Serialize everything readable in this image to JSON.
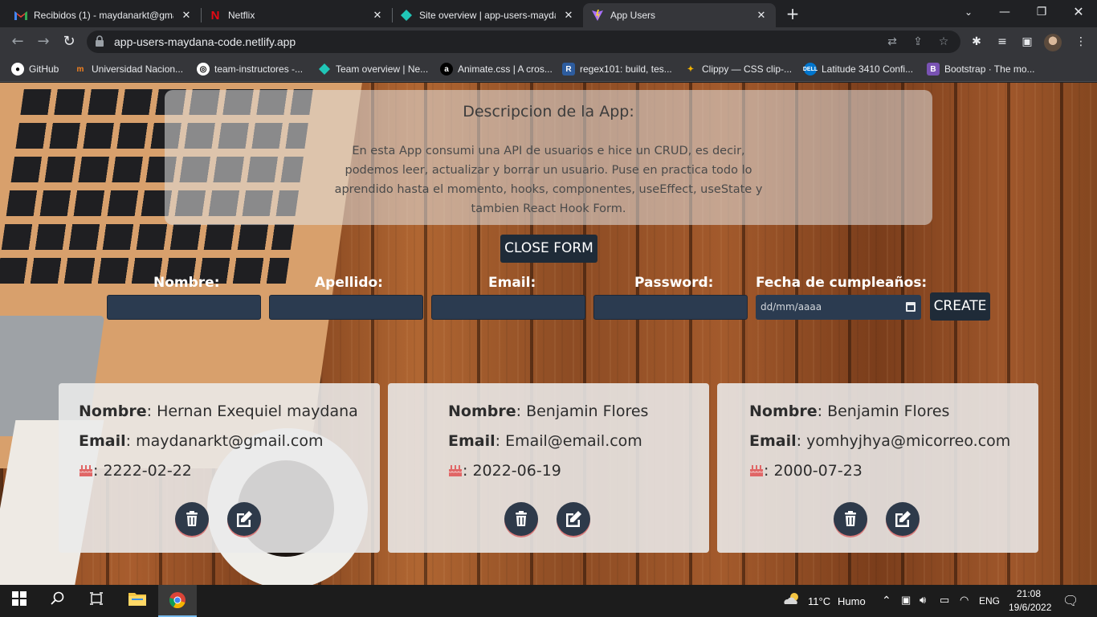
{
  "browser": {
    "tabs": [
      {
        "title": "Recibidos (1) - maydanarkt@gma",
        "icon": "gmail-icon",
        "active": false
      },
      {
        "title": "Netflix",
        "icon": "netflix-icon",
        "active": false
      },
      {
        "title": "Site overview | app-users-mayda",
        "icon": "netlify-icon",
        "active": false
      },
      {
        "title": "App Users",
        "icon": "vite-icon",
        "active": true
      }
    ],
    "url": "app-users-maydana-code.netlify.app",
    "bookmarks": [
      {
        "label": "GitHub",
        "icon": "github-icon"
      },
      {
        "label": "Universidad Nacion...",
        "icon": "university-icon"
      },
      {
        "label": "team-instructores -...",
        "icon": "team-icon"
      },
      {
        "label": "Team overview | Ne...",
        "icon": "netlify-icon"
      },
      {
        "label": "Animate.css | A cros...",
        "icon": "animate-icon"
      },
      {
        "label": "regex101: build, tes...",
        "icon": "regex-icon"
      },
      {
        "label": "Clippy — CSS clip-...",
        "icon": "clippy-icon"
      },
      {
        "label": "Latitude 3410 Confi...",
        "icon": "dell-icon"
      },
      {
        "label": "Bootstrap · The mo...",
        "icon": "bootstrap-icon"
      }
    ]
  },
  "page": {
    "description": {
      "title": "Descripcion de la App:",
      "body": "En esta App consumi una API de usuarios e hice un CRUD, es decir, podemos leer, actualizar y borrar un usuario. Puse en practica todo lo aprendido hasta el momento, hooks, componentes, useEffect, useState y tambien React Hook Form."
    },
    "close_form_label": "CLOSE FORM",
    "form": {
      "fields": [
        {
          "label": "Nombre:",
          "value": ""
        },
        {
          "label": "Apellido:",
          "value": ""
        },
        {
          "label": "Email:",
          "value": ""
        },
        {
          "label": "Password:",
          "value": ""
        }
      ],
      "birthday_label": "Fecha de cumpleaños:",
      "birthday_placeholder": "dd/mm/aaaa",
      "create_label": "CREATE"
    },
    "cards": [
      {
        "name_label": "Nombre",
        "name": "Hernan Exequiel maydana",
        "email_label": "Email",
        "email": "maydanarkt@gmail.com",
        "birthday": "2222-02-22"
      },
      {
        "name_label": "Nombre",
        "name": "Benjamin Flores",
        "email_label": "Email",
        "email": "Email@email.com",
        "birthday": "2022-06-19"
      },
      {
        "name_label": "Nombre",
        "name": "Benjamin Flores",
        "email_label": "Email",
        "email": "yomhyjhya@micorreo.com",
        "birthday": "2000-07-23"
      }
    ]
  },
  "taskbar": {
    "weather_temp": "11°C",
    "weather_text": "Humo",
    "language": "ENG",
    "time": "21:08",
    "date": "19/6/2022"
  },
  "colors": {
    "button_bg": "#1f2b38",
    "input_bg": "#2b3b50",
    "cake_icon": "#e06666"
  }
}
